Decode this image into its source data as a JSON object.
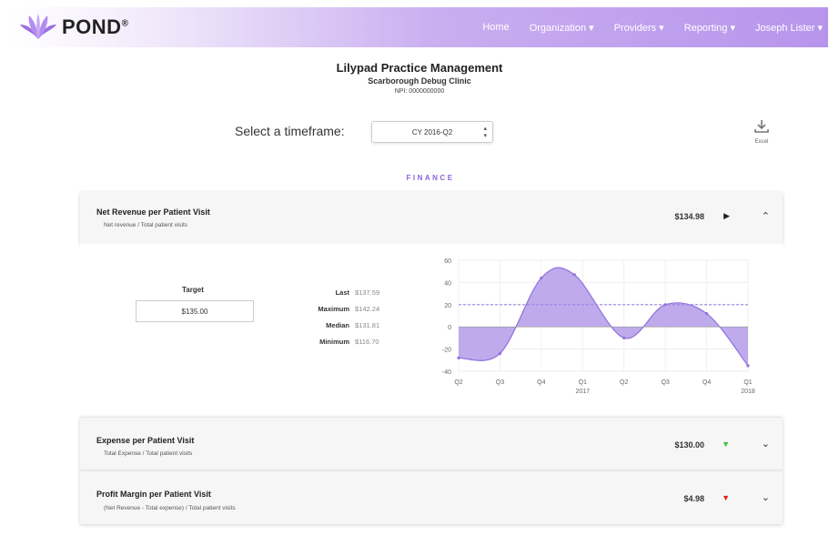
{
  "nav": {
    "brand": "POND",
    "brand_mark": "®",
    "items": [
      "Home",
      "Organization ▾",
      "Providers ▾",
      "Reporting ▾",
      "Joseph Lister ▾"
    ]
  },
  "header": {
    "title": "Lilypad Practice Management",
    "subtitle": "Scarborough Debug Clinic",
    "npi": "NPI: 0000000000"
  },
  "timeframe": {
    "label": "Select a timeframe:",
    "selected": "CY 2016-Q2"
  },
  "download": {
    "icon": "download-icon",
    "label": "Excel"
  },
  "section": "FINANCE",
  "metrics": [
    {
      "title": "Net Revenue per Patient Visit",
      "formula": "Net revenue / Total patient visits",
      "value": "$134.98",
      "indicator": "▶",
      "indicator_color": "#222222",
      "expanded": true,
      "chevron": "⌃"
    },
    {
      "title": "Expense per Patient Visit",
      "formula": "Total Expense / Total patient visits",
      "value": "$130.00",
      "indicator": "▼",
      "indicator_color": "#3cc13c",
      "expanded": false,
      "chevron": "⌄"
    },
    {
      "title": "Profit Margin per Patient Visit",
      "formula": "(Net Revenue - Total expense) / Total patient visits",
      "value": "$4.98",
      "indicator": "▼",
      "indicator_color": "#e02020",
      "expanded": false,
      "chevron": "⌄"
    }
  ],
  "detail": {
    "target_label": "Target",
    "target_value": "$135.00",
    "stats": [
      {
        "k": "Last",
        "v": "$137.59"
      },
      {
        "k": "Maximum",
        "v": "$142.24"
      },
      {
        "k": "Median",
        "v": "$131.81"
      },
      {
        "k": "Minimum",
        "v": "$116.70"
      }
    ]
  },
  "chart_data": {
    "type": "area",
    "categories": [
      "Q2",
      "Q3",
      "Q4",
      "Q1\n2017",
      "Q2",
      "Q3",
      "Q4",
      "Q1\n2018"
    ],
    "x_labels": [
      {
        "line1": "Q2",
        "line2": ""
      },
      {
        "line1": "Q3",
        "line2": ""
      },
      {
        "line1": "Q4",
        "line2": ""
      },
      {
        "line1": "Q1",
        "line2": "2017"
      },
      {
        "line1": "Q2",
        "line2": ""
      },
      {
        "line1": "Q3",
        "line2": ""
      },
      {
        "line1": "Q4",
        "line2": ""
      },
      {
        "line1": "Q1",
        "line2": "2018"
      }
    ],
    "points": [
      {
        "x": 0,
        "y": -28
      },
      {
        "x": 1,
        "y": -24
      },
      {
        "x": 2,
        "y": 44
      },
      {
        "x": 2.8,
        "y": 47
      },
      {
        "x": 4,
        "y": -10
      },
      {
        "x": 5,
        "y": 20
      },
      {
        "x": 6,
        "y": 12
      },
      {
        "x": 7,
        "y": -35
      }
    ],
    "target_line": 20,
    "yticks": [
      60,
      40,
      20,
      0,
      -20,
      -40
    ],
    "ylim": [
      -40,
      60
    ],
    "fill_color": "#b49be8",
    "line_color": "#8f70df",
    "target_color": "#9b86e6"
  }
}
